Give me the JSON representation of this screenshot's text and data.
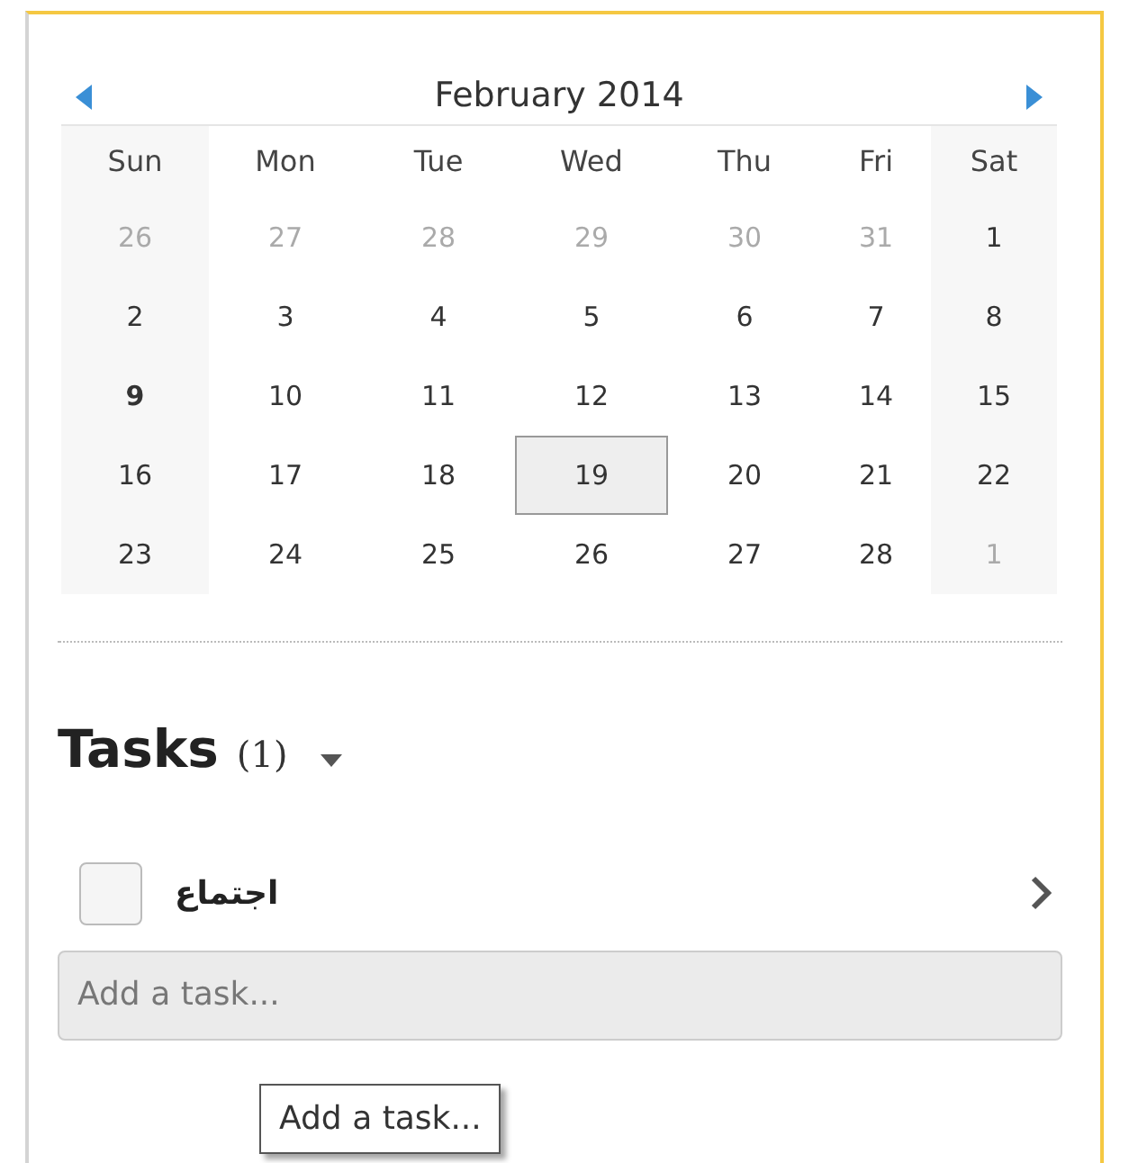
{
  "calendar": {
    "title": "February 2014",
    "weekdays": [
      "Sun",
      "Mon",
      "Tue",
      "Wed",
      "Thu",
      "Fri",
      "Sat"
    ],
    "weeks": [
      [
        {
          "label": "26",
          "muted": true,
          "today": false,
          "selected": false
        },
        {
          "label": "27",
          "muted": true,
          "today": false,
          "selected": false
        },
        {
          "label": "28",
          "muted": true,
          "today": false,
          "selected": false
        },
        {
          "label": "29",
          "muted": true,
          "today": false,
          "selected": false
        },
        {
          "label": "30",
          "muted": true,
          "today": false,
          "selected": false
        },
        {
          "label": "31",
          "muted": true,
          "today": false,
          "selected": false
        },
        {
          "label": "1",
          "muted": false,
          "today": false,
          "selected": false
        }
      ],
      [
        {
          "label": "2",
          "muted": false,
          "today": false,
          "selected": false
        },
        {
          "label": "3",
          "muted": false,
          "today": false,
          "selected": false
        },
        {
          "label": "4",
          "muted": false,
          "today": false,
          "selected": false
        },
        {
          "label": "5",
          "muted": false,
          "today": false,
          "selected": false
        },
        {
          "label": "6",
          "muted": false,
          "today": false,
          "selected": false
        },
        {
          "label": "7",
          "muted": false,
          "today": false,
          "selected": false
        },
        {
          "label": "8",
          "muted": false,
          "today": false,
          "selected": false
        }
      ],
      [
        {
          "label": "9",
          "muted": false,
          "today": true,
          "selected": false
        },
        {
          "label": "10",
          "muted": false,
          "today": false,
          "selected": false
        },
        {
          "label": "11",
          "muted": false,
          "today": false,
          "selected": false
        },
        {
          "label": "12",
          "muted": false,
          "today": false,
          "selected": false
        },
        {
          "label": "13",
          "muted": false,
          "today": false,
          "selected": false
        },
        {
          "label": "14",
          "muted": false,
          "today": false,
          "selected": false
        },
        {
          "label": "15",
          "muted": false,
          "today": false,
          "selected": false
        }
      ],
      [
        {
          "label": "16",
          "muted": false,
          "today": false,
          "selected": false
        },
        {
          "label": "17",
          "muted": false,
          "today": false,
          "selected": false
        },
        {
          "label": "18",
          "muted": false,
          "today": false,
          "selected": false
        },
        {
          "label": "19",
          "muted": false,
          "today": false,
          "selected": true
        },
        {
          "label": "20",
          "muted": false,
          "today": false,
          "selected": false
        },
        {
          "label": "21",
          "muted": false,
          "today": false,
          "selected": false
        },
        {
          "label": "22",
          "muted": false,
          "today": false,
          "selected": false
        }
      ],
      [
        {
          "label": "23",
          "muted": false,
          "today": false,
          "selected": false
        },
        {
          "label": "24",
          "muted": false,
          "today": false,
          "selected": false
        },
        {
          "label": "25",
          "muted": false,
          "today": false,
          "selected": false
        },
        {
          "label": "26",
          "muted": false,
          "today": false,
          "selected": false
        },
        {
          "label": "27",
          "muted": false,
          "today": false,
          "selected": false
        },
        {
          "label": "28",
          "muted": false,
          "today": false,
          "selected": false
        },
        {
          "label": "1",
          "muted": true,
          "today": false,
          "selected": false
        }
      ]
    ]
  },
  "tasks": {
    "heading": "Tasks",
    "count": "(1)",
    "items": [
      {
        "title": "اجتماع",
        "checked": false
      }
    ],
    "add_field": {
      "placeholder": "Add a task..."
    },
    "tooltip": "Add a task..."
  }
}
